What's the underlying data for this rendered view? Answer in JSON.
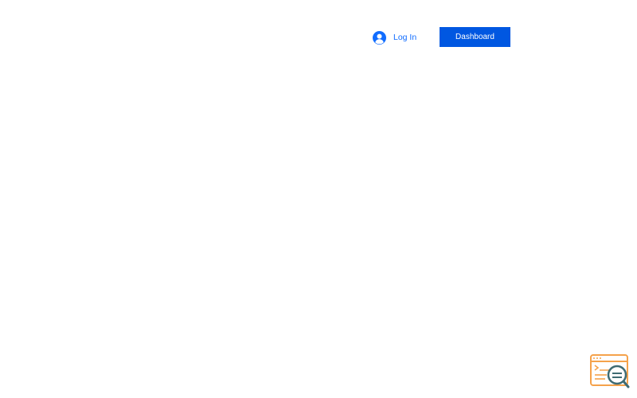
{
  "header": {
    "login_label": "Log In",
    "dashboard_label": "Dashboard"
  },
  "icons": {
    "login": "user-avatar-icon",
    "widget": "browser-search-icon"
  },
  "colors": {
    "accent_blue": "#116dff",
    "button_blue": "#0057e1",
    "widget_orange": "#f5a24b",
    "widget_teal": "#3f6b73"
  }
}
